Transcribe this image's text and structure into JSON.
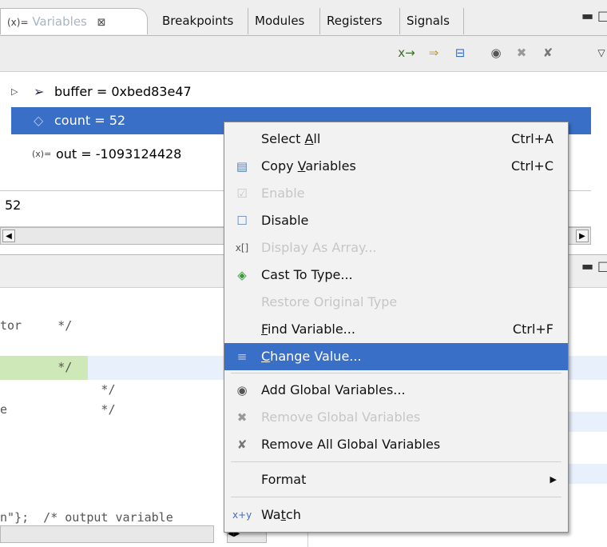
{
  "tabs": {
    "variables": "Variables",
    "breakpoints": "Breakpoints",
    "modules": "Modules",
    "registers": "Registers",
    "signals": "Signals",
    "variables_icon": "(x)=",
    "close_glyph": "⊠"
  },
  "variables": [
    {
      "label": "buffer = 0xbed83e47",
      "icon": "pointer-var-icon",
      "expandable": true
    },
    {
      "label": "count = 52",
      "icon": "local-var-icon",
      "selected": true
    },
    {
      "label": "out = -1093124428",
      "icon": "var-icon",
      "prefix": "(x)="
    }
  ],
  "detail_value": "52",
  "code_lines": [
    {
      "text": "tor     */"
    },
    {
      "text": "        */",
      "highlight": true
    },
    {
      "text": "              */"
    },
    {
      "text": "e             */"
    },
    {
      "text": "n\"};  /* output variable"
    }
  ],
  "menu": {
    "select_all": {
      "pre": "Select ",
      "key": "A",
      "post": "ll",
      "shortcut": "Ctrl+A"
    },
    "copy_vars": {
      "pre": "Copy ",
      "key": "V",
      "post": "ariables",
      "shortcut": "Ctrl+C"
    },
    "enable": "Enable",
    "disable": "Disable",
    "display_array": "Display As Array...",
    "cast_type": "Cast To Type...",
    "restore_type": "Restore Original Type",
    "find_var": {
      "key": "F",
      "post": "ind Variable...",
      "shortcut": "Ctrl+F"
    },
    "change_value": {
      "key": "C",
      "post": "hange Value..."
    },
    "add_global": "Add Global Variables...",
    "remove_global": "Remove Global Variables",
    "remove_all_global": "Remove All Global Variables",
    "format": "Format",
    "watch": {
      "pre": "Wa",
      "key": "t",
      "post": "ch"
    }
  },
  "colors": {
    "selection": "#3a6fc8",
    "disabled": "#c6c6c6"
  }
}
